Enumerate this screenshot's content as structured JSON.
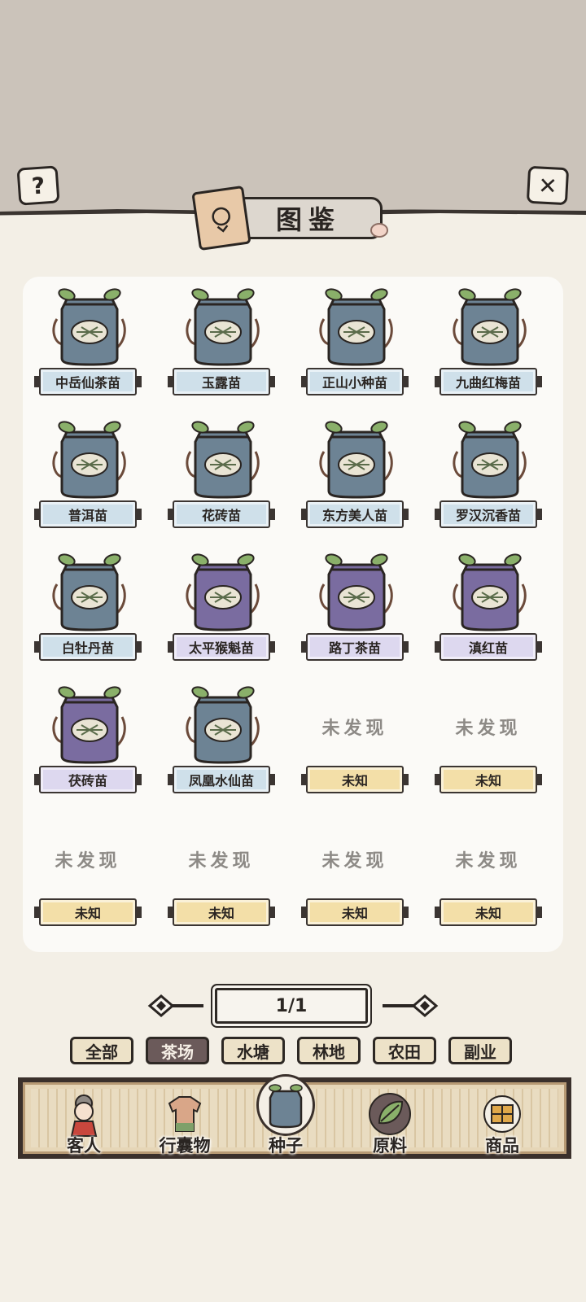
{
  "header": {
    "title": "图鉴",
    "help_icon": "question-mark-icon",
    "close_icon": "close-x-icon"
  },
  "items": [
    {
      "name": "中岳仙茶苗",
      "bag_color": "#6d8394",
      "plate": "blue"
    },
    {
      "name": "玉露苗",
      "bag_color": "#6d8394",
      "plate": "blue"
    },
    {
      "name": "正山小种苗",
      "bag_color": "#6d8394",
      "plate": "blue"
    },
    {
      "name": "九曲红梅苗",
      "bag_color": "#6d8394",
      "plate": "blue"
    },
    {
      "name": "普洱苗",
      "bag_color": "#6d8394",
      "plate": "blue"
    },
    {
      "name": "花砖苗",
      "bag_color": "#6d8394",
      "plate": "blue"
    },
    {
      "name": "东方美人苗",
      "bag_color": "#6d8394",
      "plate": "blue"
    },
    {
      "name": "罗汉沉香苗",
      "bag_color": "#6d8394",
      "plate": "blue"
    },
    {
      "name": "白牡丹苗",
      "bag_color": "#6d8394",
      "plate": "blue"
    },
    {
      "name": "太平猴魁苗",
      "bag_color": "#7a6ca0",
      "plate": "purple"
    },
    {
      "name": "路丁茶苗",
      "bag_color": "#7a6ca0",
      "plate": "purple"
    },
    {
      "name": "滇红苗",
      "bag_color": "#7a6ca0",
      "plate": "purple"
    },
    {
      "name": "茯砖苗",
      "bag_color": "#7a6ca0",
      "plate": "purple"
    },
    {
      "name": "凤凰水仙苗",
      "bag_color": "#6d8394",
      "plate": "blue"
    }
  ],
  "undiscovered": {
    "text": "未发现",
    "label": "未知",
    "count": 6
  },
  "pager": {
    "text": "1/1",
    "prev_icon": "arrow-left-icon",
    "next_icon": "arrow-right-icon"
  },
  "filters": [
    {
      "label": "全部",
      "active": false
    },
    {
      "label": "茶场",
      "active": true
    },
    {
      "label": "水塘",
      "active": false
    },
    {
      "label": "林地",
      "active": false
    },
    {
      "label": "农田",
      "active": false
    },
    {
      "label": "副业",
      "active": false
    }
  ],
  "nav": [
    {
      "label": "客人",
      "icon": "guest-girl-icon",
      "active": false
    },
    {
      "label": "行囊物",
      "icon": "clothing-icon",
      "active": false
    },
    {
      "label": "种子",
      "icon": "seed-bag-icon",
      "active": true
    },
    {
      "label": "原料",
      "icon": "leaf-icon",
      "active": false
    },
    {
      "label": "商品",
      "icon": "goods-box-icon",
      "active": false
    }
  ],
  "colors": {
    "background": "#f3efe6",
    "top_band": "#cbc3ba",
    "plate_blue": "#cfe0ea",
    "plate_purple": "#ddd8ef",
    "plate_gold": "#f3dfa8",
    "filter_active": "#6b5a5a"
  }
}
